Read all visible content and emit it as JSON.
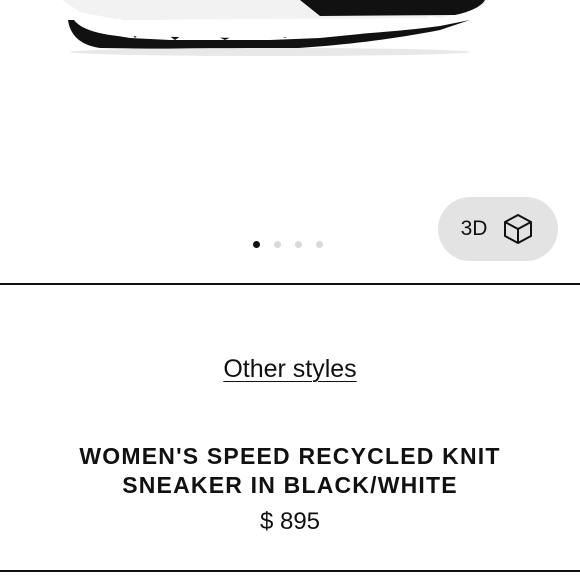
{
  "gallery": {
    "dots_count": 4,
    "active_dot": 0,
    "view_3d_label": "3D"
  },
  "product": {
    "other_styles_link": "Other styles",
    "title": "WOMEN'S SPEED RECYCLED KNIT SNEAKER IN BLACK/WHITE",
    "price": "$ 895"
  },
  "colors": {
    "text": "#111111",
    "background": "#ffffff",
    "pill_background": "#e3e3e3",
    "dot_inactive": "#d9d9d9"
  },
  "icons": {
    "view_3d": "cube-icon"
  }
}
